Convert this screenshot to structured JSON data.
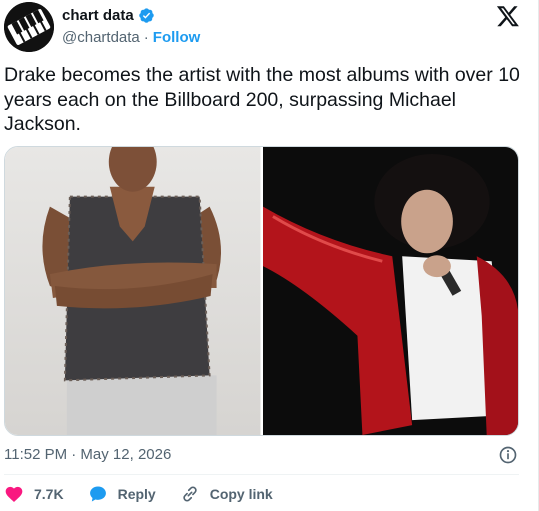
{
  "account": {
    "display_name": "chart data",
    "handle": "@chartdata",
    "separator": "·",
    "follow_label": "Follow"
  },
  "tweet": {
    "text": "Drake becomes the artist with the most albums with over 10 years each on the Billboard 200, surpassing Michael Jackson.",
    "timestamp": "11:52 PM · May 12, 2026"
  },
  "actions": {
    "like_count": "7.7K",
    "reply_label": "Reply",
    "copy_link_label": "Copy link"
  },
  "colors": {
    "accent": "#1d9bf0",
    "like": "#f91880",
    "text_secondary": "#536471"
  },
  "icons": {
    "verified": "verified-badge-icon",
    "platform": "x-logo-icon",
    "info": "info-icon",
    "like": "heart-icon",
    "reply": "speech-bubble-icon",
    "copy_link": "link-icon"
  }
}
